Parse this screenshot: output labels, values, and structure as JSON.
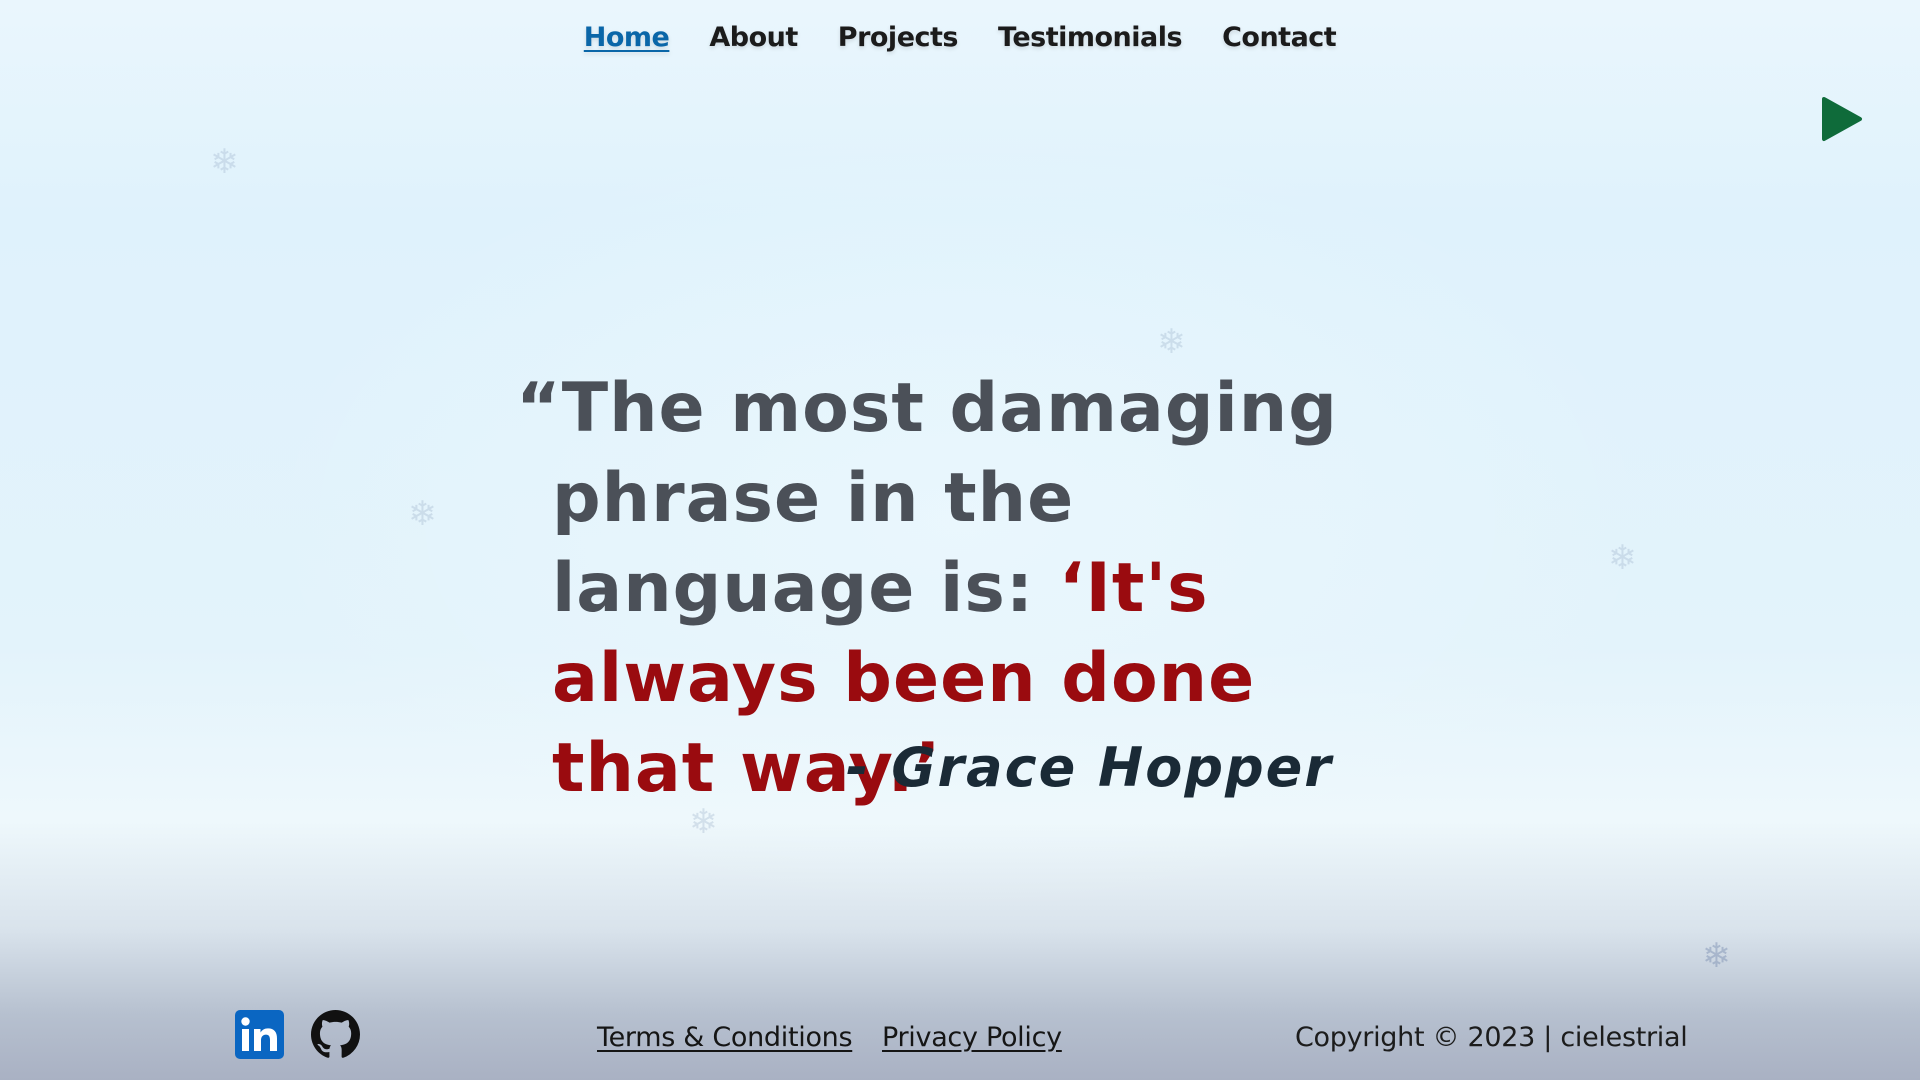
{
  "nav": {
    "items": [
      {
        "label": "Home",
        "active": true
      },
      {
        "label": "About",
        "active": false
      },
      {
        "label": "Projects",
        "active": false
      },
      {
        "label": "Testimonials",
        "active": false
      },
      {
        "label": "Contact",
        "active": false
      }
    ]
  },
  "media": {
    "icon": "play-icon",
    "color": "#0f6b3a"
  },
  "quote": {
    "open_mark": "“",
    "text_plain": "The most damaging phrase in the language is: ",
    "text_highlight": "‘It's always been done that way.’",
    "author": "- Grace Hopper",
    "text_color": "#4b5058",
    "highlight_color": "#9a0b0f"
  },
  "footer": {
    "social": [
      {
        "icon": "linkedin-icon",
        "color": "#0a66c2"
      },
      {
        "icon": "github-icon",
        "color": "#111111"
      }
    ],
    "links": {
      "terms": "Terms & Conditions",
      "privacy": "Privacy Policy"
    },
    "copyright": "Copyright © 2023 | cielestrial"
  }
}
